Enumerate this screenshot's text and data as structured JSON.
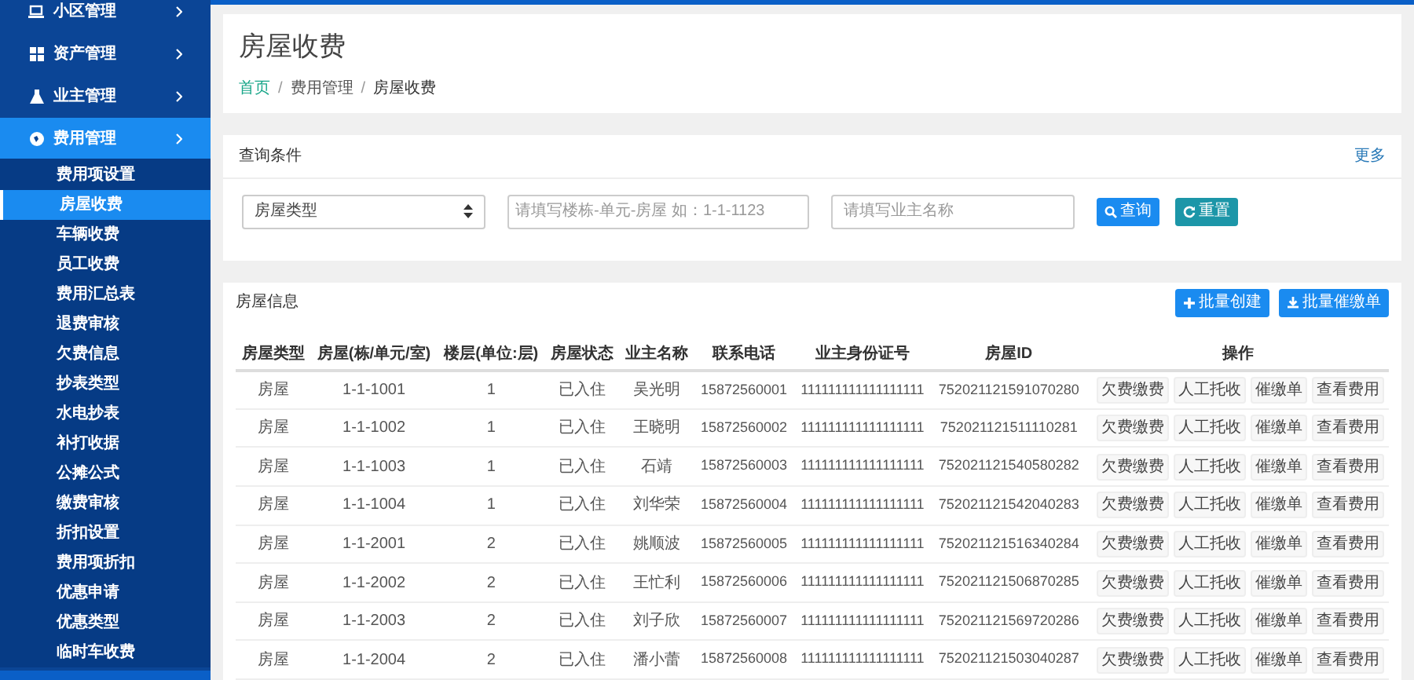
{
  "sidebar": {
    "items": [
      {
        "label": "小区管理",
        "selected": false,
        "expanded": false
      },
      {
        "label": "资产管理",
        "selected": false,
        "expanded": false
      },
      {
        "label": "业主管理",
        "selected": false,
        "expanded": false
      },
      {
        "label": "费用管理",
        "selected": true,
        "expanded": true,
        "children": [
          {
            "label": "费用项设置",
            "selected": false
          },
          {
            "label": "房屋收费",
            "selected": true
          },
          {
            "label": "车辆收费",
            "selected": false
          },
          {
            "label": "员工收费",
            "selected": false
          },
          {
            "label": "费用汇总表",
            "selected": false
          },
          {
            "label": "退费审核",
            "selected": false
          },
          {
            "label": "欠费信息",
            "selected": false
          },
          {
            "label": "抄表类型",
            "selected": false
          },
          {
            "label": "水电抄表",
            "selected": false
          },
          {
            "label": "补打收据",
            "selected": false
          },
          {
            "label": "公摊公式",
            "selected": false
          },
          {
            "label": "缴费审核",
            "selected": false
          },
          {
            "label": "折扣设置",
            "selected": false
          },
          {
            "label": "费用项折扣",
            "selected": false
          },
          {
            "label": "优惠申请",
            "selected": false
          },
          {
            "label": "优惠类型",
            "selected": false
          },
          {
            "label": "临时车收费",
            "selected": false
          }
        ]
      }
    ]
  },
  "page_title": "房屋收费",
  "breadcrumb": [
    "首页",
    "/",
    "费用管理",
    "/",
    "房屋收费"
  ],
  "query": {
    "title": "查询条件",
    "more": "更多",
    "type_select": "房屋类型",
    "room_field": {
      "placeholder": "请填写楼栋-单元-房屋 如：1-1-1123"
    },
    "owner_field": {
      "placeholder": "请填写业主名称"
    },
    "search_button": "查询",
    "reset_button": "重置"
  },
  "table": {
    "title": "房屋信息",
    "buttons": [
      "批量创建",
      "批量催缴单"
    ],
    "columns": [
      "房屋类型",
      "房屋(栋/单元/室)",
      "楼层(单位:层)",
      "房屋状态",
      "业主名称",
      "联系电话",
      "业主身份证号",
      "房屋ID",
      "操作"
    ],
    "rows": [
      {
        "cells": [
          "房屋",
          "1-1-1001",
          "1",
          "已入住",
          "吴光明",
          "15872560001",
          "111111111111111111",
          "752021121591070280"
        ],
        "actions": [
          "欠费缴费",
          "人工托收",
          "催缴单",
          "查看费用"
        ]
      },
      {
        "cells": [
          "房屋",
          "1-1-1002",
          "1",
          "已入住",
          "王晓明",
          "15872560002",
          "111111111111111111",
          "752021121511110281"
        ],
        "actions": [
          "欠费缴费",
          "人工托收",
          "催缴单",
          "查看费用"
        ]
      },
      {
        "cells": [
          "房屋",
          "1-1-1003",
          "1",
          "已入住",
          "石靖",
          "15872560003",
          "111111111111111111",
          "752021121540580282"
        ],
        "actions": [
          "欠费缴费",
          "人工托收",
          "催缴单",
          "查看费用"
        ]
      },
      {
        "cells": [
          "房屋",
          "1-1-1004",
          "1",
          "已入住",
          "刘华荣",
          "15872560004",
          "111111111111111111",
          "752021121542040283"
        ],
        "actions": [
          "欠费缴费",
          "人工托收",
          "催缴单",
          "查看费用"
        ]
      },
      {
        "cells": [
          "房屋",
          "1-1-2001",
          "2",
          "已入住",
          "姚顺波",
          "15872560005",
          "111111111111111111",
          "752021121516340284"
        ],
        "actions": [
          "欠费缴费",
          "人工托收",
          "催缴单",
          "查看费用"
        ]
      },
      {
        "cells": [
          "房屋",
          "1-1-2002",
          "2",
          "已入住",
          "王忙利",
          "15872560006",
          "111111111111111111",
          "752021121506870285"
        ],
        "actions": [
          "欠费缴费",
          "人工托收",
          "催缴单",
          "查看费用"
        ]
      },
      {
        "cells": [
          "房屋",
          "1-1-2003",
          "2",
          "已入住",
          "刘子欣",
          "15872560007",
          "111111111111111111",
          "752021121569720286"
        ],
        "actions": [
          "欠费缴费",
          "人工托收",
          "催缴单",
          "查看费用"
        ]
      },
      {
        "cells": [
          "房屋",
          "1-1-2004",
          "2",
          "已入住",
          "潘小蕾",
          "15872560008",
          "111111111111111111",
          "752021121503040287"
        ],
        "actions": [
          "欠费缴费",
          "人工托收",
          "催缴单",
          "查看费用"
        ]
      }
    ]
  }
}
